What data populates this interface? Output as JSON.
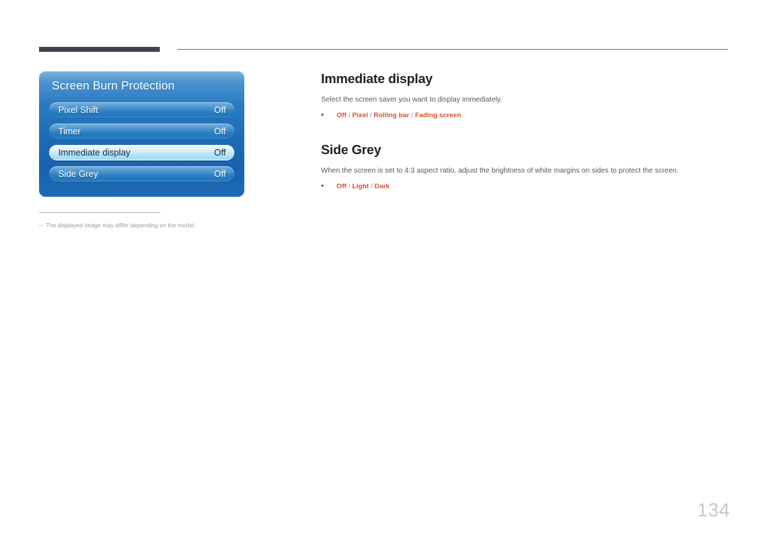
{
  "document": {
    "page_number": "134"
  },
  "osd": {
    "title": "Screen Burn Protection",
    "rows": [
      {
        "label": "Pixel Shift",
        "value": "Off",
        "selected": false
      },
      {
        "label": "Timer",
        "value": "Off",
        "selected": false
      },
      {
        "label": "Immediate display",
        "value": "Off",
        "selected": true
      },
      {
        "label": "Side Grey",
        "value": "Off",
        "selected": false
      }
    ]
  },
  "footnote": {
    "marker": "–",
    "text": "The displayed image may differ depending on the model."
  },
  "sections": [
    {
      "heading": "Immediate display",
      "description": "Select the screen saver you want to display immediately.",
      "bullet": "•",
      "options": "Off / Pixel / Rolling bar / Fading screen"
    },
    {
      "heading": "Side Grey",
      "description": "When the screen is set to 4:3 aspect ratio, adjust the brightness of white margins on sides to protect the screen.",
      "bullet": "•",
      "options": "Off / Light / Dark"
    }
  ],
  "colors": {
    "accent_orange": "#d9532b",
    "rule_dark": "#45404f",
    "panel_blue": "#1e6cb5",
    "page_number": "#c5c6d4"
  }
}
